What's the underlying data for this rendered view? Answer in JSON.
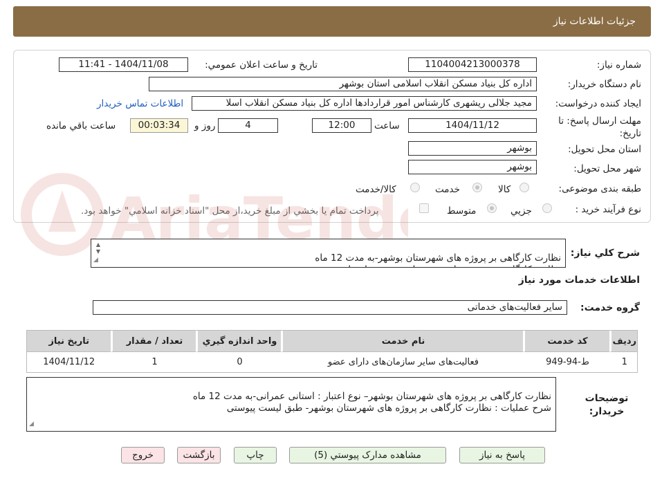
{
  "header": {
    "title": "جزئیات اطلاعات نیاز"
  },
  "form": {
    "need_number_label": "شماره نیاز:",
    "need_number": "1104004213000378",
    "announce_label": "تاریخ و ساعت اعلان عمومي:",
    "announce_value": "1404/11/08 - 11:41",
    "buyer_org_label": "نام دستگاه خريدار:",
    "buyer_org": "اداره کل بنیاد مسکن انقلاب اسلامی استان بوشهر",
    "creator_label": "ايجاد کننده درخواست:",
    "creator": "مجید جلالی ریشهری کارشناس امور قراردادها اداره کل بنیاد مسکن انقلاب اسلا",
    "contact_link": "اطلاعات تماس خريدار",
    "deadline_label": "مهلت ارسال پاسخ: تا تاريخ:",
    "deadline_date": "1404/11/12",
    "time_label": "ساعت",
    "deadline_time": "12:00",
    "days_value": "4",
    "days_label": "روز و",
    "remaining_value": "00:03:34",
    "remaining_label": "ساعت باقي مانده",
    "province_label": "استان محل تحویل:",
    "province": "بوشهر",
    "city_label": "شهر محل تحویل:",
    "city": "بوشهر",
    "category_label": "طبقه بندی موضوعی:",
    "category_options": [
      "کالا",
      "خدمت",
      "کالا/خدمت"
    ],
    "process_label": "نوع فرآيند خريد :",
    "process_options": [
      "جزيي",
      "متوسط"
    ],
    "payment_note": "پرداخت تمام يا بخشي از مبلغ خريد،از محل \"اسناد خزانه اسلامي\" خواهد بود."
  },
  "watermark_text": "AriaTender.neT",
  "summary": {
    "label": "شرح کلي نياز:",
    "text": "نظارت کارگاهی  بر پروژه های شهرستان بوشهر-به مدت 12 ماه\nنظارت کارگاهی  بر پروژه های شهرستان بوشهر- طبق لیست پیوستی"
  },
  "services": {
    "title": "اطلاعات خدمات مورد نياز",
    "group_label": "گروه خدمت:",
    "group_value": "ساير فعاليت‌هاى خدماتى",
    "columns": [
      "رديف",
      "کد خدمت",
      "نام خدمت",
      "واحد اندازه گيري",
      "تعداد / مقدار",
      "تاريخ نياز"
    ],
    "rows": [
      [
        "1",
        "ط-94-949",
        "فعاليت‌هاى ساير سازمان‌هاى داراى عضو",
        "0",
        "1",
        "1404/11/12"
      ]
    ]
  },
  "buyer_notes": {
    "label": "توضيحات خريدار:",
    "text": "نظارت کارگاهی  بر پروژه های شهرستان بوشهر– نوع اعتبار : استانی عمرانی-به مدت 12 ماه\nشرح عملیات : نظارت کارگاهی  بر پروژه های شهرستان بوشهر- طبق لیست پیوستی"
  },
  "buttons": {
    "reply": "پاسخ به نياز",
    "attachments": "مشاهده مدارک پيوستي (5)",
    "print": "چاپ",
    "back": "بازگشت",
    "exit": "خروج"
  }
}
